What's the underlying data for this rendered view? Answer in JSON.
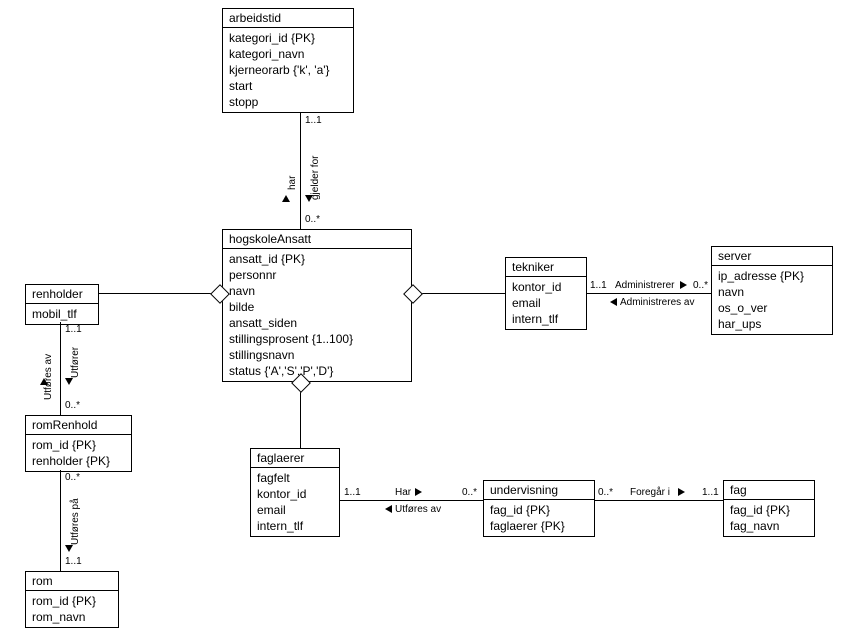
{
  "entities": {
    "arbeidstid": {
      "title": "arbeidstid",
      "attrs": [
        "kategori_id {PK}",
        "kategori_navn",
        "kjerneorarb {'k', 'a'}",
        "start",
        "stopp"
      ]
    },
    "hogskoleAnsatt": {
      "title": "hogskoleAnsatt",
      "attrs": [
        "ansatt_id {PK}",
        "personnr",
        "navn",
        "bilde",
        "ansatt_siden",
        "stillingsprosent {1..100}",
        "stillingsnavn",
        "status {'A','S','P','D'}"
      ]
    },
    "renholder": {
      "title": "renholder",
      "attrs": [
        "mobil_tlf"
      ]
    },
    "romRenhold": {
      "title": "romRenhold",
      "attrs": [
        "rom_id {PK}",
        "renholder {PK}"
      ]
    },
    "rom": {
      "title": "rom",
      "attrs": [
        "rom_id {PK}",
        "rom_navn"
      ]
    },
    "faglaerer": {
      "title": "faglaerer",
      "attrs": [
        "fagfelt",
        "kontor_id",
        "email",
        "intern_tlf"
      ]
    },
    "tekniker": {
      "title": "tekniker",
      "attrs": [
        "kontor_id",
        "email",
        "intern_tlf"
      ]
    },
    "server": {
      "title": "server",
      "attrs": [
        "ip_adresse {PK}",
        "navn",
        "os_o_ver",
        "har_ups"
      ]
    },
    "undervisning": {
      "title": "undervisning",
      "attrs": [
        "fag_id {PK}",
        "faglaerer {PK}"
      ]
    },
    "fag": {
      "title": "fag",
      "attrs": [
        "fag_id {PK}",
        "fag_navn"
      ]
    }
  },
  "relations": {
    "arbeidstid_hogskoleAnsatt": {
      "top": "1..1",
      "bottom": "0..*",
      "label1": "har",
      "label2": "gjelder for"
    },
    "renholder_romRenhold": {
      "top": "1..1",
      "bottom": "0..*",
      "label1": "Utføres av",
      "label2": "Utfører"
    },
    "romRenhold_rom": {
      "top": "0..*",
      "bottom": "1..1",
      "label": "Utføres på"
    },
    "tekniker_server": {
      "left": "1..1",
      "right": "0..*",
      "label1": "Administrerer",
      "label2": "Administreres av"
    },
    "faglaerer_undervisning": {
      "left": "1..1",
      "right": "0..*",
      "label1": "Har",
      "label2": "Utføres av"
    },
    "undervisning_fag": {
      "left": "0..*",
      "right": "1..1",
      "label": "Foregår i"
    }
  }
}
